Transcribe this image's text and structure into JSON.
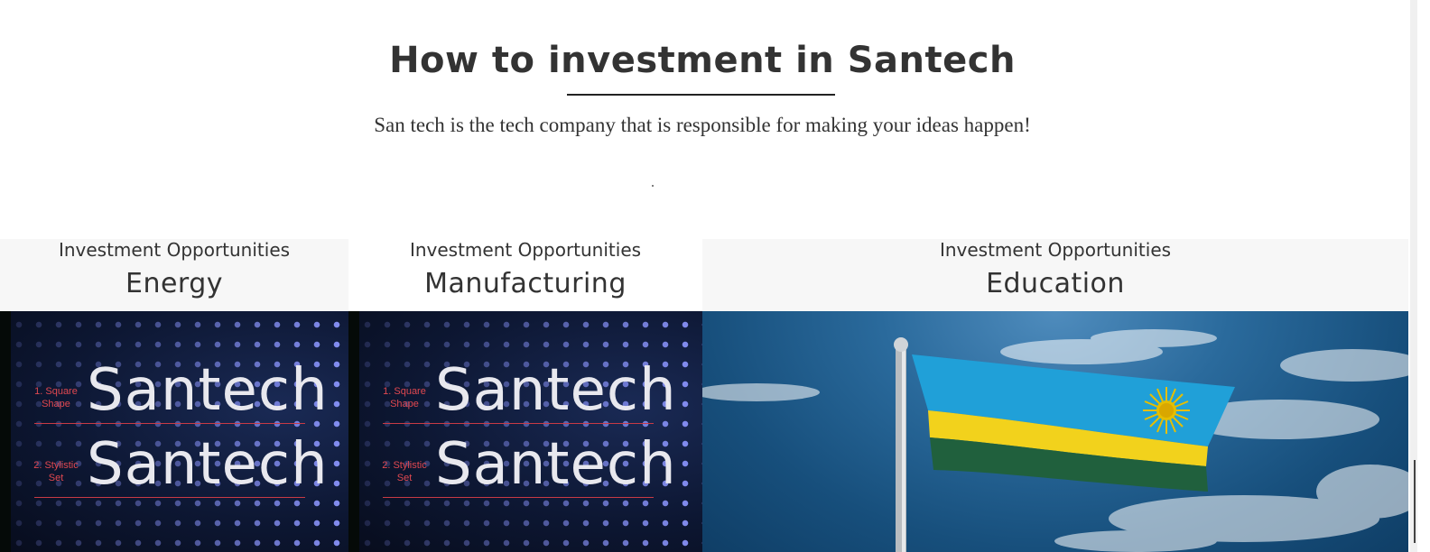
{
  "section": {
    "title": "How to investment in Santech",
    "subtitle": "San tech is the tech company that is responsible for making your ideas happen!"
  },
  "cards": [
    {
      "kicker": "Investment Opportunities",
      "title": "Energy",
      "image": {
        "word_1": "Santech",
        "word_2": "Santech",
        "note_1": "1. Square Shape",
        "note_2": "2. Stylistic Set"
      }
    },
    {
      "kicker": "Investment Opportunities",
      "title": "Manufacturing",
      "image": {
        "word_1": "Santech",
        "word_2": "Santech",
        "note_1": "1. Square Shape",
        "note_2": "2. Stylistic Set"
      }
    },
    {
      "kicker": "Investment Opportunities",
      "title": "Education",
      "image": {
        "subject": "flag-of-rwanda"
      }
    }
  ],
  "colors": {
    "text": "#333333",
    "panel": "#f7f7f7",
    "flag_blue": "#20a0d8",
    "flag_yellow": "#f2d21c",
    "flag_green": "#20603d",
    "sun": "#e5be01"
  }
}
